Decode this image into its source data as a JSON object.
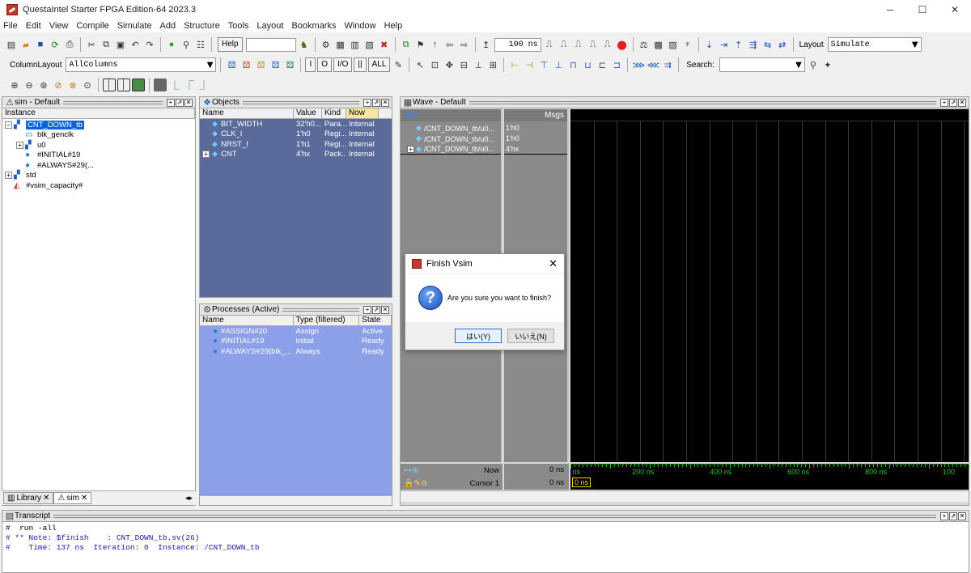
{
  "window": {
    "title": "QuestaIntel Starter FPGA Edition-64 2023.3",
    "controls": [
      "─",
      "☐",
      "✕"
    ]
  },
  "menu": [
    "File",
    "Edit",
    "View",
    "Compile",
    "Simulate",
    "Add",
    "Structure",
    "Tools",
    "Layout",
    "Bookmarks",
    "Window",
    "Help"
  ],
  "toolbar": {
    "help_label": "Help",
    "help_value": "",
    "time_value": "100 ns",
    "layout_label": "Layout",
    "layout_value": "Simulate",
    "column_layout_label": "ColumnLayout",
    "column_layout_value": "AllColumns",
    "search_label": "Search:",
    "search_value": "",
    "obj_buttons": [
      "I",
      "O",
      "I/O",
      "||",
      "ALL"
    ]
  },
  "sim_panel": {
    "title": "sim - Default",
    "column": "Instance",
    "tree": [
      {
        "label": "CNT_DOWN_tb",
        "level": 0,
        "expander": "−",
        "icon": "module-icon",
        "selected": true
      },
      {
        "label": "blk_genclk",
        "level": 1,
        "expander": "",
        "icon": "block-icon"
      },
      {
        "label": "u0",
        "level": 1,
        "expander": "+",
        "icon": "module-icon"
      },
      {
        "label": "#INITIAL#19",
        "level": 1,
        "expander": "",
        "icon": "process-icon"
      },
      {
        "label": "#ALWAYS#29(...",
        "level": 1,
        "expander": "",
        "icon": "process-icon"
      },
      {
        "label": "std",
        "level": 0,
        "expander": "+",
        "icon": "module-icon"
      },
      {
        "label": "#vsim_capacity#",
        "level": 0,
        "expander": "",
        "icon": "capacity-icon"
      }
    ],
    "tabs": [
      {
        "label": "Library"
      },
      {
        "label": "sim"
      }
    ]
  },
  "objects_panel": {
    "title": "Objects",
    "columns": [
      "Name",
      "Value",
      "Kind",
      "Now"
    ],
    "rows": [
      {
        "expander": "",
        "name": "BIT_WIDTH",
        "value": "32'h0...",
        "kind": "Para...",
        "mode": "Internal"
      },
      {
        "expander": "",
        "name": "CLK_I",
        "value": "1'h0",
        "kind": "Regi...",
        "mode": "Internal"
      },
      {
        "expander": "",
        "name": "NRST_I",
        "value": "1'h1",
        "kind": "Regi...",
        "mode": "Internal"
      },
      {
        "expander": "+",
        "name": "CNT",
        "value": "4'hx",
        "kind": "Pack...",
        "mode": "Internal"
      }
    ]
  },
  "processes_panel": {
    "title": "Processes (Active)",
    "columns": [
      "Name",
      "Type (filtered)",
      "State"
    ],
    "rows": [
      {
        "name": "#ASSIGN#20",
        "type": "Assign",
        "state": "Active"
      },
      {
        "name": "#INITIAL#19",
        "type": "Initial",
        "state": "Ready"
      },
      {
        "name": "#ALWAYS#29(blk_...",
        "type": "Always",
        "state": "Ready"
      }
    ]
  },
  "wave_panel": {
    "title": "Wave - Default",
    "msgs_label": "Msgs",
    "signals": [
      {
        "expander": "",
        "name": "/CNT_DOWN_tb/u0...",
        "value": "1'h0"
      },
      {
        "expander": "",
        "name": "/CNT_DOWN_tb/u0...",
        "value": "1'h0"
      },
      {
        "expander": "+",
        "name": "/CNT_DOWN_tb/u0...",
        "value": "4'hx"
      }
    ],
    "now_label": "Now",
    "now_value": "0 ns",
    "cursor_label": "Cursor 1",
    "cursor_value": "0 ns",
    "cursor_marker": "0 ns",
    "timeline": [
      "ns",
      "200 ns",
      "400 ns",
      "600 ns",
      "800 ns",
      "100"
    ],
    "grid_lines": 17,
    "colors": {
      "background": "#000000",
      "grid": "#3a3a3a",
      "timeline": "#22c022",
      "cursor": "#f0d000"
    }
  },
  "dialog": {
    "title": "Finish Vsim",
    "message": "Are you sure you want to finish?",
    "yes_label": "はい(Y)",
    "no_label": "いいえ(N)",
    "close": "✕"
  },
  "transcript": {
    "title": "Transcript",
    "lines": [
      "#  run -all",
      "# ** Note: $finish    : CNT_DOWN_tb.sv(26)",
      "#    Time: 137 ns  Iteration: 0  Instance: /CNT_DOWN_tb"
    ],
    "line_colors": [
      "#000000",
      "#1a1aa0",
      "#1a1aa0"
    ]
  }
}
